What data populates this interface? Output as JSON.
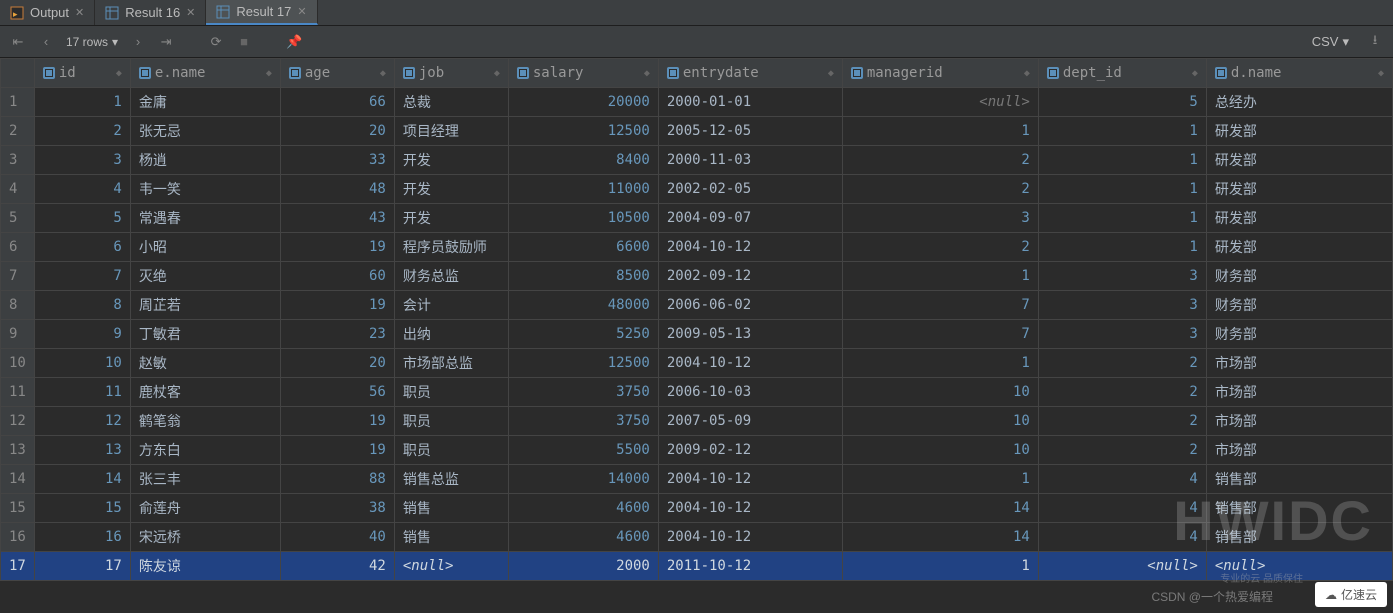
{
  "tabs": [
    {
      "label": "Output",
      "icon": "output"
    },
    {
      "label": "Result 16",
      "icon": "grid"
    },
    {
      "label": "Result 17",
      "icon": "grid",
      "active": true
    }
  ],
  "toolbar": {
    "rows_label": "17 rows",
    "export_label": "CSV"
  },
  "columns": [
    {
      "key": "id",
      "label": "id",
      "align": "right"
    },
    {
      "key": "ename",
      "label": "e.name",
      "align": "left"
    },
    {
      "key": "age",
      "label": "age",
      "align": "right"
    },
    {
      "key": "job",
      "label": "job",
      "align": "left"
    },
    {
      "key": "salary",
      "label": "salary",
      "align": "right"
    },
    {
      "key": "entrydate",
      "label": "entrydate",
      "align": "left"
    },
    {
      "key": "managerid",
      "label": "managerid",
      "align": "right"
    },
    {
      "key": "dept_id",
      "label": "dept_id",
      "align": "right"
    },
    {
      "key": "dname",
      "label": "d.name",
      "align": "left"
    }
  ],
  "rows": [
    {
      "id": 1,
      "ename": "金庸",
      "age": 66,
      "job": "总裁",
      "salary": 20000,
      "entrydate": "2000-01-01",
      "managerid": null,
      "dept_id": 5,
      "dname": "总经办"
    },
    {
      "id": 2,
      "ename": "张无忌",
      "age": 20,
      "job": "项目经理",
      "salary": 12500,
      "entrydate": "2005-12-05",
      "managerid": 1,
      "dept_id": 1,
      "dname": "研发部"
    },
    {
      "id": 3,
      "ename": "杨逍",
      "age": 33,
      "job": "开发",
      "salary": 8400,
      "entrydate": "2000-11-03",
      "managerid": 2,
      "dept_id": 1,
      "dname": "研发部"
    },
    {
      "id": 4,
      "ename": "韦一笑",
      "age": 48,
      "job": "开发",
      "salary": 11000,
      "entrydate": "2002-02-05",
      "managerid": 2,
      "dept_id": 1,
      "dname": "研发部"
    },
    {
      "id": 5,
      "ename": "常遇春",
      "age": 43,
      "job": "开发",
      "salary": 10500,
      "entrydate": "2004-09-07",
      "managerid": 3,
      "dept_id": 1,
      "dname": "研发部"
    },
    {
      "id": 6,
      "ename": "小昭",
      "age": 19,
      "job": "程序员鼓励师",
      "salary": 6600,
      "entrydate": "2004-10-12",
      "managerid": 2,
      "dept_id": 1,
      "dname": "研发部"
    },
    {
      "id": 7,
      "ename": "灭绝",
      "age": 60,
      "job": "财务总监",
      "salary": 8500,
      "entrydate": "2002-09-12",
      "managerid": 1,
      "dept_id": 3,
      "dname": "财务部"
    },
    {
      "id": 8,
      "ename": "周芷若",
      "age": 19,
      "job": "会计",
      "salary": 48000,
      "entrydate": "2006-06-02",
      "managerid": 7,
      "dept_id": 3,
      "dname": "财务部"
    },
    {
      "id": 9,
      "ename": "丁敏君",
      "age": 23,
      "job": "出纳",
      "salary": 5250,
      "entrydate": "2009-05-13",
      "managerid": 7,
      "dept_id": 3,
      "dname": "财务部"
    },
    {
      "id": 10,
      "ename": "赵敏",
      "age": 20,
      "job": "市场部总监",
      "salary": 12500,
      "entrydate": "2004-10-12",
      "managerid": 1,
      "dept_id": 2,
      "dname": "市场部"
    },
    {
      "id": 11,
      "ename": "鹿杖客",
      "age": 56,
      "job": "职员",
      "salary": 3750,
      "entrydate": "2006-10-03",
      "managerid": 10,
      "dept_id": 2,
      "dname": "市场部"
    },
    {
      "id": 12,
      "ename": "鹤笔翁",
      "age": 19,
      "job": "职员",
      "salary": 3750,
      "entrydate": "2007-05-09",
      "managerid": 10,
      "dept_id": 2,
      "dname": "市场部"
    },
    {
      "id": 13,
      "ename": "方东白",
      "age": 19,
      "job": "职员",
      "salary": 5500,
      "entrydate": "2009-02-12",
      "managerid": 10,
      "dept_id": 2,
      "dname": "市场部"
    },
    {
      "id": 14,
      "ename": "张三丰",
      "age": 88,
      "job": "销售总监",
      "salary": 14000,
      "entrydate": "2004-10-12",
      "managerid": 1,
      "dept_id": 4,
      "dname": "销售部"
    },
    {
      "id": 15,
      "ename": "俞莲舟",
      "age": 38,
      "job": "销售",
      "salary": 4600,
      "entrydate": "2004-10-12",
      "managerid": 14,
      "dept_id": 4,
      "dname": "销售部"
    },
    {
      "id": 16,
      "ename": "宋远桥",
      "age": 40,
      "job": "销售",
      "salary": 4600,
      "entrydate": "2004-10-12",
      "managerid": 14,
      "dept_id": 4,
      "dname": "销售部"
    },
    {
      "id": 17,
      "ename": "陈友谅",
      "age": 42,
      "job": null,
      "salary": 2000,
      "entrydate": "2011-10-12",
      "managerid": 1,
      "dept_id": null,
      "dname": null
    }
  ],
  "null_label": "<null>",
  "selected_row_index": 16,
  "watermark": "HWIDC",
  "csdn_text": "CSDN @一个热爱编程",
  "yisu_text": "亿速云",
  "yisu_sub": "专业的云 品质保住"
}
